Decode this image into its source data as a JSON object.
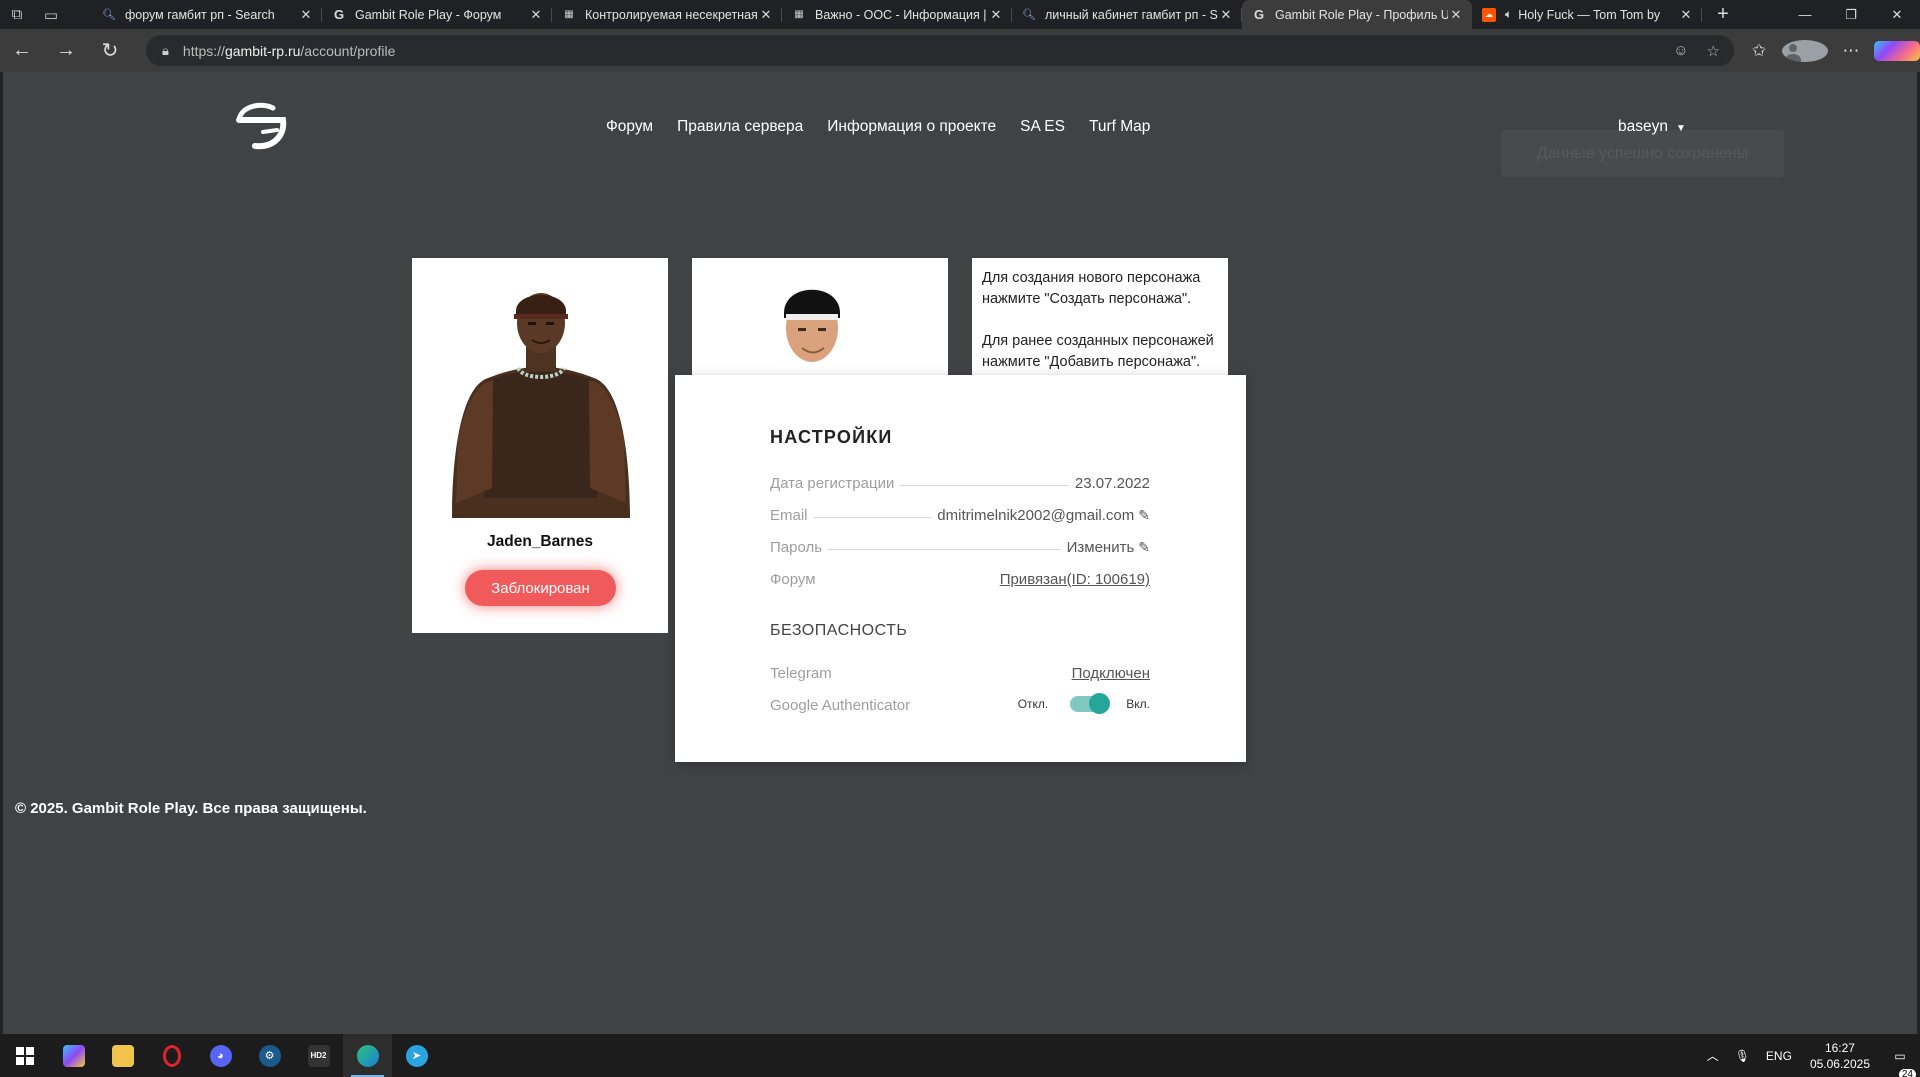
{
  "browser": {
    "tabs": [
      {
        "title": "форум гамбит рп - Search",
        "favicon": "search-icon"
      },
      {
        "title": "Gambit Role Play - Форум",
        "favicon": "gambit-icon"
      },
      {
        "title": "Контролируемая несекретная",
        "favicon": "vk-icon"
      },
      {
        "title": "Важно - ООС - Информация |",
        "favicon": "vk-icon"
      },
      {
        "title": "личный кабинет гамбит рп - S",
        "favicon": "search-icon"
      },
      {
        "title": "Gambit Role Play - Профиль UC",
        "favicon": "gambit-icon",
        "active": true
      },
      {
        "title": "Holy Fuck — Tom Tom by",
        "favicon": "soundcloud-icon",
        "audio": true
      }
    ],
    "url_prefix": "https://",
    "url_host": "gambit-rp.ru",
    "url_path": "/account/profile"
  },
  "site": {
    "nav": [
      "Форум",
      "Правила сервера",
      "Информация о проекте",
      "SA ES",
      "Turf Map"
    ],
    "username": "baseyn",
    "toast": "Данные успешно сохранены"
  },
  "characters": [
    {
      "name": "Jaden_Barnes",
      "status": "Заблокирован"
    }
  ],
  "info": {
    "line1": "Для создания нового персонажа нажмите \"Создать персонажа\".",
    "line2": "Для ранее созданных персонажей нажмите \"Добавить персонажа\"."
  },
  "settings": {
    "title": "НАСТРОЙКИ",
    "rows": [
      {
        "label": "Дата регистрации",
        "value": "23.07.2022"
      },
      {
        "label": "Email",
        "value": "dmitrimelnik2002@gmail.com"
      },
      {
        "label": "Пароль",
        "value": "Изменить"
      },
      {
        "label": "Форум",
        "value": "Привязан(ID: 100619)"
      }
    ],
    "security_title": "БЕЗОПАСНОСТЬ",
    "telegram_label": "Telegram",
    "telegram_value": "Подключен",
    "ga_label": "Google Authenticator",
    "ga_off": "Откл.",
    "ga_on": "Вкл.",
    "ga_enabled": true
  },
  "footer": "© 2025. Gambit Role Play. Все права защищены.",
  "taskbar": {
    "lang": "ENG",
    "time": "16:27",
    "date": "05.06.2025",
    "notifications": "24"
  },
  "colors": {
    "page_bg": "#414244",
    "accent_red": "#f05a5a",
    "toggle_teal": "#26a69a"
  }
}
